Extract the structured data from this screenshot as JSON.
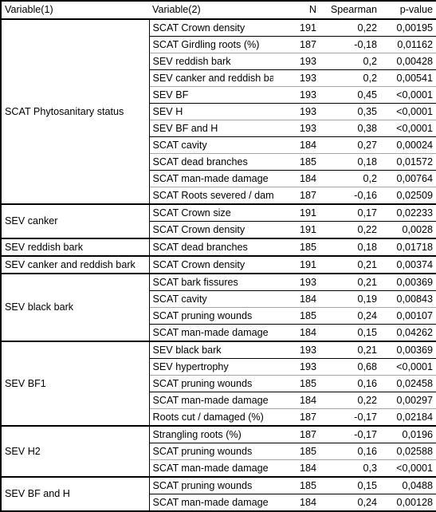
{
  "table": {
    "columns": [
      {
        "key": "variable1",
        "label": "Variable(1)",
        "align": "left"
      },
      {
        "key": "variable2",
        "label": "Variable(2)",
        "align": "left"
      },
      {
        "key": "n",
        "label": "N",
        "align": "right"
      },
      {
        "key": "spearman",
        "label": "Spearman",
        "align": "right"
      },
      {
        "key": "pvalue",
        "label": "p-value",
        "align": "right"
      }
    ],
    "groups": [
      {
        "variable1": "SCAT Phytosanitary status",
        "rows": [
          {
            "variable2": "SCAT Crown density",
            "n": "191",
            "spearman": "0,22",
            "pvalue": "0,00195"
          },
          {
            "variable2": "SCAT Girdling roots (%)",
            "n": "187",
            "spearman": "-0,18",
            "pvalue": "0,01162"
          },
          {
            "variable2": "SEV reddish bark",
            "n": "193",
            "spearman": "0,2",
            "pvalue": "0,00428"
          },
          {
            "variable2": "SEV canker and reddish bark",
            "n": "193",
            "spearman": "0,2",
            "pvalue": "0,00541"
          },
          {
            "variable2": "SEV BF",
            "n": "193",
            "spearman": "0,45",
            "pvalue": "<0,0001"
          },
          {
            "variable2": "SEV H",
            "n": "193",
            "spearman": "0,35",
            "pvalue": "<0,0001"
          },
          {
            "variable2": "SEV BF and H",
            "n": "193",
            "spearman": "0,38",
            "pvalue": "<0,0001"
          },
          {
            "variable2": "SCAT cavity",
            "n": "184",
            "spearman": "0,27",
            "pvalue": "0,00024"
          },
          {
            "variable2": "SCAT dead branches",
            "n": "185",
            "spearman": "0,18",
            "pvalue": "0,01572"
          },
          {
            "variable2": "SCAT man-made damage",
            "n": "184",
            "spearman": "0,2",
            "pvalue": "0,00764"
          },
          {
            "variable2": "SCAT Roots severed / damaged (%)",
            "n": "187",
            "spearman": "-0,16",
            "pvalue": "0,02509",
            "small": true
          }
        ]
      },
      {
        "variable1": "SEV canker",
        "rows": [
          {
            "variable2": "SCAT Crown size",
            "n": "191",
            "spearman": "0,17",
            "pvalue": "0,02233"
          },
          {
            "variable2": "SCAT Crown density",
            "n": "191",
            "spearman": "0,22",
            "pvalue": "0,0028"
          }
        ]
      },
      {
        "variable1": "SEV reddish bark",
        "rows": [
          {
            "variable2": "SCAT dead branches",
            "n": "185",
            "spearman": "0,18",
            "pvalue": "0,01718"
          }
        ]
      },
      {
        "variable1": "SEV canker and reddish bark",
        "rows": [
          {
            "variable2": "SCAT Crown density",
            "n": "191",
            "spearman": "0,21",
            "pvalue": "0,00374"
          }
        ]
      },
      {
        "variable1": "SEV black bark",
        "rows": [
          {
            "variable2": "SCAT bark fissures",
            "n": "193",
            "spearman": "0,21",
            "pvalue": "0,00369"
          },
          {
            "variable2": "SCAT cavity",
            "n": "184",
            "spearman": "0,19",
            "pvalue": "0,00843"
          },
          {
            "variable2": "SCAT pruning wounds",
            "n": "185",
            "spearman": "0,24",
            "pvalue": "0,00107"
          },
          {
            "variable2": "SCAT man-made damage",
            "n": "184",
            "spearman": "0,15",
            "pvalue": "0,04262"
          }
        ]
      },
      {
        "variable1": "SEV BF1",
        "rows": [
          {
            "variable2": "SEV black bark",
            "n": "193",
            "spearman": "0,21",
            "pvalue": "0,00369"
          },
          {
            "variable2": "SEV hypertrophy",
            "n": "193",
            "spearman": "0,68",
            "pvalue": "<0,0001"
          },
          {
            "variable2": "SCAT pruning wounds",
            "n": "185",
            "spearman": "0,16",
            "pvalue": "0,02458"
          },
          {
            "variable2": "SCAT man-made damage",
            "n": "184",
            "spearman": "0,22",
            "pvalue": "0,00297"
          },
          {
            "variable2": "Roots cut / damaged (%)",
            "n": "187",
            "spearman": "-0,17",
            "pvalue": "0,02184"
          }
        ]
      },
      {
        "variable1": "SEV H2",
        "rows": [
          {
            "variable2": "Strangling roots (%)",
            "n": "187",
            "spearman": "-0,17",
            "pvalue": "0,0196"
          },
          {
            "variable2": "SCAT pruning wounds",
            "n": "185",
            "spearman": "0,16",
            "pvalue": "0,02588"
          },
          {
            "variable2": "SCAT man-made damage",
            "n": "184",
            "spearman": "0,3",
            "pvalue": "<0,0001"
          }
        ]
      },
      {
        "variable1": "SEV BF and H",
        "rows": [
          {
            "variable2": "SCAT pruning wounds",
            "n": "185",
            "spearman": "0,15",
            "pvalue": "0,0488"
          },
          {
            "variable2": "SCAT man-made damage",
            "n": "184",
            "spearman": "0,24",
            "pvalue": "0,00128"
          }
        ]
      }
    ]
  },
  "colors": {
    "rule_strong": "#000000",
    "rule_light": "#a6a6a6",
    "text": "#000000",
    "background": "#ffffff"
  }
}
